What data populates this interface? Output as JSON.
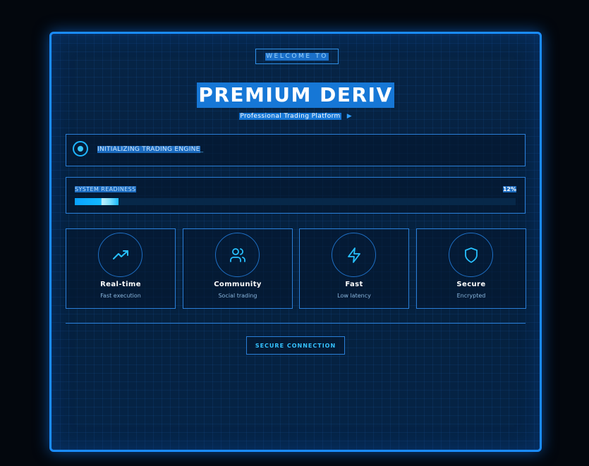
{
  "header": {
    "welcome": "WELCOME TO",
    "title": "PREMIUM DERIV",
    "subtitle": "Professional Trading Platform",
    "subtitle_arrow": "▶"
  },
  "status": {
    "text": "INITIALIZING TRADING ENGINE",
    "cursor": "_"
  },
  "readiness": {
    "label": "SYSTEM READINESS",
    "percent_label": "12%",
    "progress_fraction": 0.12
  },
  "features": [
    {
      "icon": "trending-up-icon",
      "title": "Real-time",
      "subtitle": "Fast execution"
    },
    {
      "icon": "users-icon",
      "title": "Community",
      "subtitle": "Social trading"
    },
    {
      "icon": "lightning-icon",
      "title": "Fast",
      "subtitle": "Low latency"
    },
    {
      "icon": "shield-icon",
      "title": "Secure",
      "subtitle": "Encrypted"
    }
  ],
  "footer": {
    "secure_button": "SECURE CONNECTION"
  },
  "colors": {
    "accent": "#1a8cff",
    "cyan": "#1fb6ff",
    "background": "#03070d"
  }
}
